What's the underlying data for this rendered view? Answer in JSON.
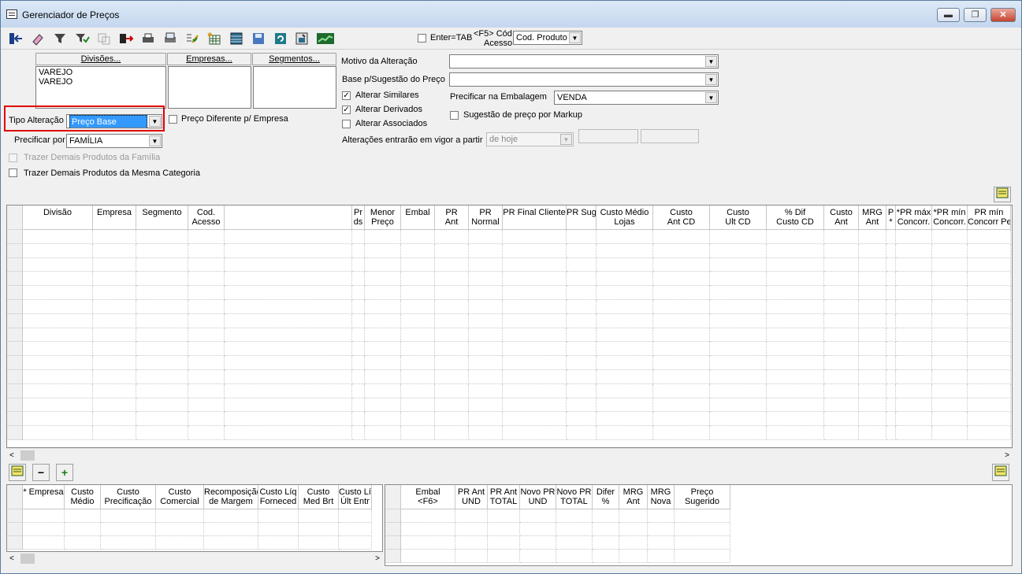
{
  "window": {
    "title": "Gerenciador de Preços",
    "min": "▬",
    "max": "❐",
    "close": "✕"
  },
  "toolbar": {
    "icons": [
      "exit-icon",
      "eraser-icon",
      "filter-icon",
      "filter-check-icon",
      "copy-disabled-icon",
      "export-icon",
      "print-icon",
      "printer-preview-icon",
      "edit-check-icon",
      "star-grid-icon",
      "table-icon",
      "save-icon",
      "refresh-icon",
      "window-icon",
      "chart-icon"
    ],
    "enter_tab": "Enter=TAB",
    "f5_line1": "<F5> Cód",
    "f5_line2": "Acesso",
    "cod_value": "Cod. Produto"
  },
  "filters": {
    "divisoes": "Divisões...",
    "empresas": "Empresas...",
    "segmentos": "Segmentos...",
    "divisoes_items": [
      "VAREJO",
      "VAREJO"
    ],
    "tipo_alteracao_label": "Tipo Alteração",
    "tipo_alteracao_value": "Preço Base",
    "preco_diferente": "Preço Diferente p/ Empresa",
    "precificar_por_label": "Precificar por",
    "precificar_por_value": "FAMÍLIA",
    "trazer_familia": "Trazer Demais Produtos da Família",
    "trazer_categoria": "Trazer Demais Produtos da Mesma Categoria"
  },
  "options": {
    "motivo_label": "Motivo da Alteração",
    "motivo_value": "",
    "base_label": "Base p/Sugestão do Preço",
    "base_value": "",
    "alterar_similares": "Alterar Similares",
    "alterar_derivados": "Alterar Derivados",
    "alterar_associados": "Alterar Associados",
    "precificar_embalagem_label": "Precificar na Embalagem",
    "precificar_embalagem_value": "VENDA",
    "sugestao_markup": "Sugestão de preço por Markup",
    "vigor_label": "Alterações entrarão em vigor a partir",
    "vigor_value": "de hoje"
  },
  "main_grid": {
    "columns": [
      {
        "l1": "Divisão",
        "l2": ""
      },
      {
        "l1": "Empresa",
        "l2": ""
      },
      {
        "l1": "Segmento",
        "l2": ""
      },
      {
        "l1": "Cod.",
        "l2": "Acesso"
      },
      {
        "l1": "",
        "l2": ""
      },
      {
        "l1": "Pr",
        "l2": "ds"
      },
      {
        "l1": "Menor",
        "l2": "Preço"
      },
      {
        "l1": "Embal",
        "l2": ""
      },
      {
        "l1": "PR",
        "l2": "Ant"
      },
      {
        "l1": "PR",
        "l2": "Normal"
      },
      {
        "l1": "PR Final Cliente",
        "l2": ""
      },
      {
        "l1": "PR Sug",
        "l2": ""
      },
      {
        "l1": "Custo Médio",
        "l2": "Lojas"
      },
      {
        "l1": "Custo",
        "l2": "Ant CD"
      },
      {
        "l1": "Custo",
        "l2": "Ult CD"
      },
      {
        "l1": "% Dif",
        "l2": "Custo CD"
      },
      {
        "l1": "Custo",
        "l2": "Ant"
      },
      {
        "l1": "MRG",
        "l2": "Ant"
      },
      {
        "l1": "P",
        "l2": "*"
      },
      {
        "l1": "*PR máx",
        "l2": "Concorr."
      },
      {
        "l1": "*PR mín",
        "l2": "Concorr."
      },
      {
        "l1": "PR mín",
        "l2": "Concorr Pe"
      }
    ]
  },
  "bottom_left_grid": {
    "columns": [
      {
        "l1": "* Empresa",
        "l2": ""
      },
      {
        "l1": "Custo",
        "l2": "Médio"
      },
      {
        "l1": "Custo",
        "l2": "Precificação"
      },
      {
        "l1": "Custo",
        "l2": "Comercial"
      },
      {
        "l1": "Recomposição",
        "l2": "de Margem"
      },
      {
        "l1": "Custo Líq",
        "l2": "Forneced"
      },
      {
        "l1": "Custo",
        "l2": "Med Brt"
      },
      {
        "l1": "Custo Líq",
        "l2": "Últ Entr"
      }
    ]
  },
  "bottom_right_grid": {
    "columns": [
      {
        "l1": "Embal",
        "l2": "<F6>"
      },
      {
        "l1": "PR Ant",
        "l2": "UND"
      },
      {
        "l1": "PR Ant",
        "l2": "TOTAL"
      },
      {
        "l1": "Novo PR",
        "l2": "UND"
      },
      {
        "l1": "Novo PR",
        "l2": "TOTAL"
      },
      {
        "l1": "Difer",
        "l2": "%"
      },
      {
        "l1": "MRG",
        "l2": "Ant"
      },
      {
        "l1": "MRG",
        "l2": "Nova"
      },
      {
        "l1": "Preço",
        "l2": "Sugerido"
      }
    ]
  },
  "buttons": {
    "minus": "−",
    "plus": "+"
  }
}
